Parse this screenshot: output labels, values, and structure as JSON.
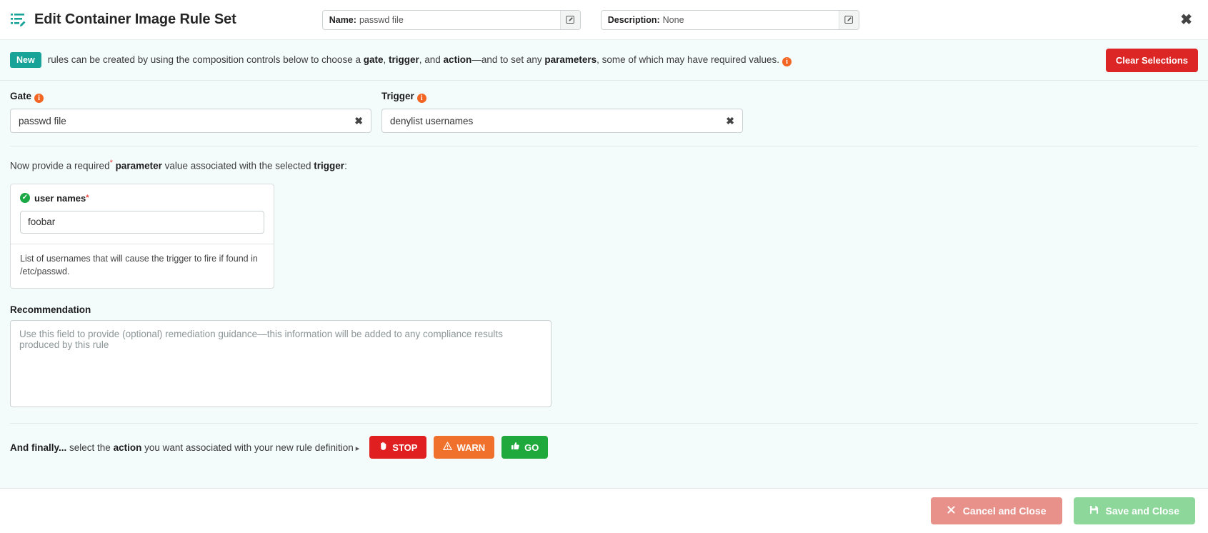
{
  "titlebar": {
    "icon": "rule-set-edit-icon",
    "title": "Edit Container Image Rule Set",
    "name_field": {
      "key": "Name:",
      "value": "passwd file",
      "edit_icon": "pencil-square-icon"
    },
    "description_field": {
      "key": "Description:",
      "value": "None",
      "edit_icon": "pencil-square-icon"
    },
    "close_icon": "✖"
  },
  "banner": {
    "badge": "New",
    "text_1": "rules can be created by using the composition controls below to choose a ",
    "bold_gate": "gate",
    "text_2": ", ",
    "bold_trigger": "trigger",
    "text_3": ", and ",
    "bold_action": "action",
    "text_4": "—and to set any ",
    "bold_parameters": "parameters",
    "text_5": ", some of which may have required values.",
    "info_icon": "i",
    "clear_button": "Clear Selections"
  },
  "gate": {
    "label": "Gate",
    "info_icon": "i",
    "value": "passwd file",
    "clear_icon": "✖"
  },
  "trigger": {
    "label": "Trigger",
    "info_icon": "i",
    "value": "denylist usernames",
    "clear_icon": "✖"
  },
  "parameter_section": {
    "instruction_1": "Now provide a required",
    "required_star": "*",
    "instruction_2": " ",
    "bold_parameter": "parameter",
    "instruction_3": " value associated with the selected ",
    "bold_trigger": "trigger",
    "instruction_4": ":",
    "card": {
      "status_icon": "✓",
      "name": "user names",
      "required_star": "*",
      "input_value": "foobar",
      "input_placeholder": "",
      "help_text": "List of usernames that will cause the trigger to fire if found in /etc/passwd."
    }
  },
  "recommendation": {
    "label": "Recommendation",
    "placeholder": "Use this field to provide (optional) remediation guidance—this information will be added to any compliance results produced by this rule",
    "value": ""
  },
  "action_section": {
    "bold_lead": "And finally...",
    "text_1": " select the ",
    "bold_action": "action",
    "text_2": " you want associated with your new rule definition",
    "caret": "▸",
    "buttons": [
      {
        "label": "STOP",
        "icon": "hand-stop-icon",
        "color": "#e02020"
      },
      {
        "label": "WARN",
        "icon": "warning-triangle-icon",
        "color": "#f0712b"
      },
      {
        "label": "GO",
        "icon": "thumbs-up-icon",
        "color": "#1fa83c"
      }
    ]
  },
  "footer": {
    "cancel_button": {
      "label": "Cancel and Close",
      "icon": "x-icon"
    },
    "save_button": {
      "label": "Save and Close",
      "icon": "floppy-disk-icon"
    }
  },
  "colors": {
    "background": "#f4fcfb",
    "brand_teal": "#17a398",
    "info_orange": "#f26522",
    "danger_red": "#dc2626",
    "success_green": "#19a844"
  }
}
